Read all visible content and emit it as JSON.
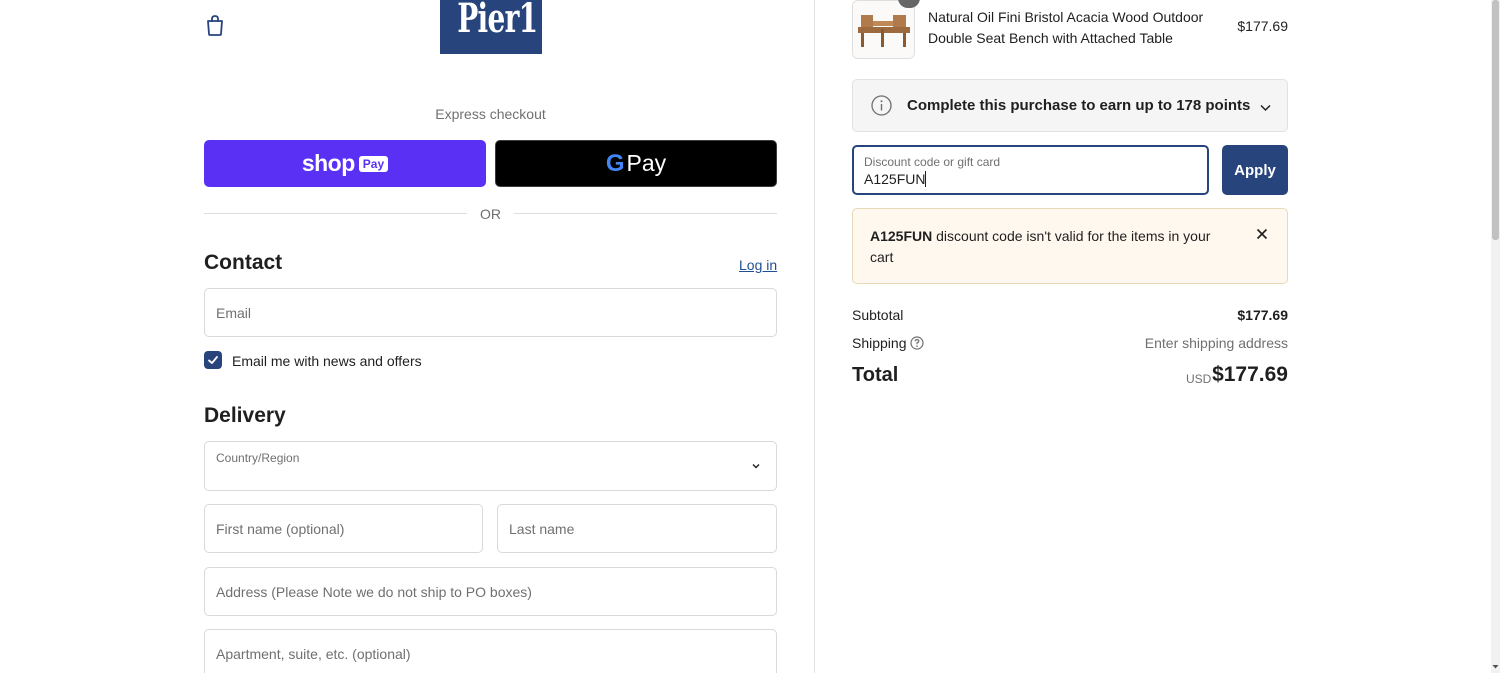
{
  "header": {
    "logo_text": "Pier1"
  },
  "express": {
    "label": "Express checkout",
    "shop_pay_word": "shop",
    "shop_pay_box": "Pay",
    "gpay_g": "G",
    "gpay_word": "Pay",
    "or_text": "OR"
  },
  "contact": {
    "title": "Contact",
    "login_label": "Log in",
    "email_placeholder": "Email",
    "news_label": "Email me with news and offers",
    "news_checked": true
  },
  "delivery": {
    "title": "Delivery",
    "country_label": "Country/Region",
    "first_name_placeholder": "First name (optional)",
    "last_name_placeholder": "Last name",
    "address_placeholder": "Address (Please Note we do not ship to PO boxes)",
    "apartment_placeholder": "Apartment, suite, etc. (optional)"
  },
  "summary": {
    "product": {
      "name": "Natural Oil Fini Bristol Acacia Wood Outdoor Double Seat Bench with Attached Table",
      "price": "$177.69"
    },
    "points_text": "Complete this purchase to earn up to 178 points",
    "discount": {
      "label": "Discount code or gift card",
      "value": "A125FUN",
      "apply_label": "Apply"
    },
    "error": {
      "code": "A125FUN",
      "message": " discount code isn't valid for the items in your cart"
    },
    "subtotal_label": "Subtotal",
    "subtotal_value": "$177.69",
    "shipping_label": "Shipping",
    "shipping_value": "Enter shipping address",
    "total_label": "Total",
    "currency": "USD",
    "total_value": "$177.69"
  },
  "colors": {
    "brand": "#27447d",
    "shop_pay": "#5a31f4",
    "error_bg": "#fff8ef"
  }
}
